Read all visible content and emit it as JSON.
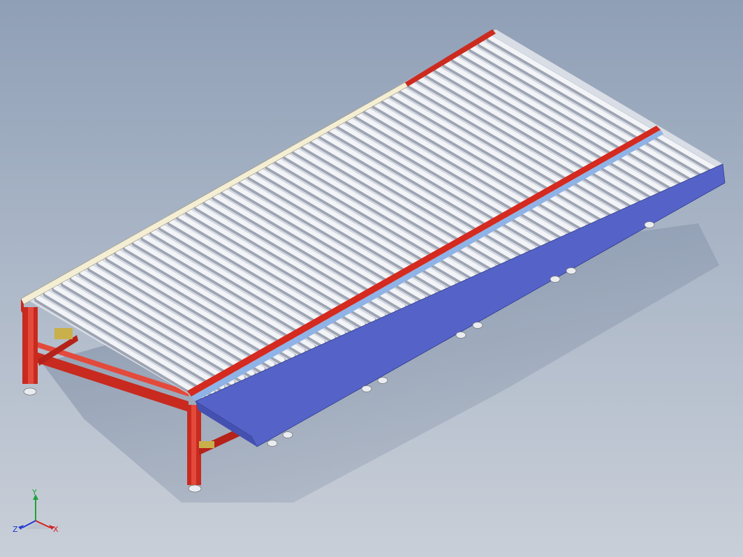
{
  "triad": {
    "x_label": "X",
    "y_label": "Y",
    "z_label": "Z"
  },
  "colors": {
    "frame_red": "#d42a1f",
    "side_rail_blue": "#5563c8",
    "guide_rail_light_blue": "#8fb3e6",
    "guide_rail_cream": "#f3eed4",
    "roller_white": "#eef0f4",
    "background_top": "#8f9fb6",
    "background_bottom": "#c9cfd8"
  }
}
